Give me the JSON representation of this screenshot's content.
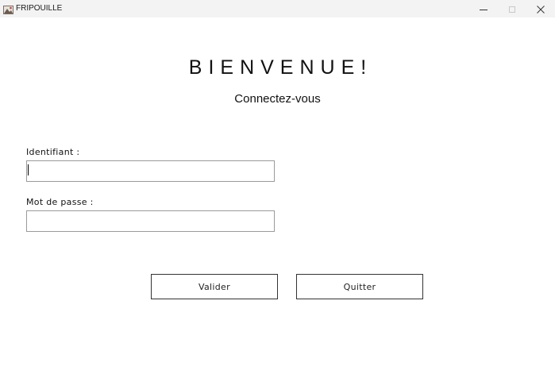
{
  "window": {
    "title": "FRIPOUILLE",
    "controls": {
      "minimize_icon": "minimize-icon",
      "maximize_icon": "maximize-icon",
      "close_icon": "close-icon"
    }
  },
  "main": {
    "heading": "BIENVENUE!",
    "subheading": "Connectez-vous"
  },
  "form": {
    "username_label": "Identifiant :",
    "username_value": "",
    "password_label": "Mot de passe :",
    "password_value": ""
  },
  "actions": {
    "validate_label": "Valider",
    "quit_label": "Quitter"
  }
}
